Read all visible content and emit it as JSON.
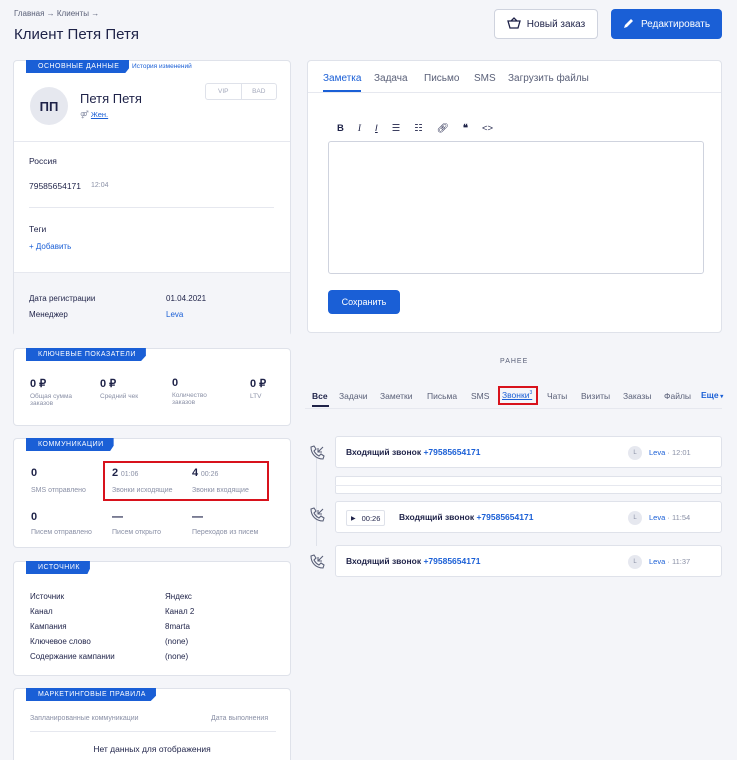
{
  "breadcrumb": {
    "text": "Главная → Клиенты →"
  },
  "page": {
    "title": "Клиент Петя Петя"
  },
  "header": {
    "new_order": "Новый заказ",
    "edit": "Редактировать"
  },
  "basic": {
    "banner": "ОСНОВНЫЕ ДАННЫЕ",
    "history_link": "История изменений",
    "initials": "ПП",
    "name": "Петя Петя",
    "gender": "Жен.",
    "vip": "VIP",
    "bad": "BAD",
    "country": "Россия",
    "phone": "79585654171",
    "phone_time": "12:04",
    "tags_label": "Теги",
    "add_label": "+ Добавить",
    "reg_label": "Дата регистрации",
    "reg_value": "01.04.2021",
    "manager_label": "Менеджер",
    "manager_value": "Leva"
  },
  "kpi": {
    "banner": "КЛЮЧЕВЫЕ ПОКАЗАТЕЛИ",
    "items": [
      {
        "value": "0 ₽",
        "label": "Общая сумма заказов"
      },
      {
        "value": "0 ₽",
        "label": "Средний чек"
      },
      {
        "value": "0",
        "label": "Количество заказов"
      },
      {
        "value": "0 ₽",
        "label": "LTV"
      }
    ]
  },
  "comm": {
    "banner": "КОММУНИКАЦИИ",
    "sms_value": "0",
    "sms_label": "SMS отправлено",
    "out_value": "2",
    "out_time": "01:06",
    "out_label": "Звонки исходящие",
    "in_value": "4",
    "in_time": "00:26",
    "in_label": "Звонки входящие",
    "letters_value": "0",
    "letters_label": "Писем отправлено",
    "opened_value": "—",
    "opened_label": "Писем открыто",
    "clicks_value": "—",
    "clicks_label": "Переходов из писем"
  },
  "source": {
    "banner": "ИСТОЧНИК",
    "rows": [
      {
        "label": "Источник",
        "value": "Яндекс"
      },
      {
        "label": "Канал",
        "value": "Канал 2"
      },
      {
        "label": "Кампания",
        "value": "8marta"
      },
      {
        "label": "Ключевое слово",
        "value": "(none)"
      },
      {
        "label": "Содержание кампании",
        "value": "(none)"
      }
    ]
  },
  "marketing": {
    "banner": "МАРКЕТИНГОВЫЕ ПРАВИЛА",
    "col1": "Запланированные коммуникации",
    "col2": "Дата выполнения",
    "empty": "Нет данных для отображения"
  },
  "editor": {
    "tabs": [
      "Заметка",
      "Задача",
      "Письмо",
      "SMS",
      "Загрузить файлы"
    ],
    "toolbar": [
      "B",
      "I",
      "Ix",
      "ul",
      "ol",
      "link",
      "quote",
      "code"
    ],
    "save": "Сохранить"
  },
  "feed": {
    "earlier": "РАНЕЕ",
    "filters": [
      "Все",
      "Задачи",
      "Заметки",
      "Письма",
      "SMS",
      "Звонки",
      "Чаты",
      "Визиты",
      "Заказы",
      "Файлы"
    ],
    "calls_count": "3",
    "more": "Еще",
    "calls": [
      {
        "title": "Входящий звонок",
        "phone": "+79585654171",
        "avatar": "L",
        "manager": "Leva",
        "time": "12:01"
      },
      {
        "duration": "00:26",
        "title": "Входящий звонок",
        "phone": "+79585654171",
        "avatar": "L",
        "manager": "Leva",
        "time": "11:54"
      },
      {
        "title": "Входящий звонок",
        "phone": "+79585654171",
        "avatar": "L",
        "manager": "Leva",
        "time": "11:37"
      }
    ]
  },
  "colors": {
    "accent": "#1a5fd6",
    "highlight": "#d8121c"
  }
}
